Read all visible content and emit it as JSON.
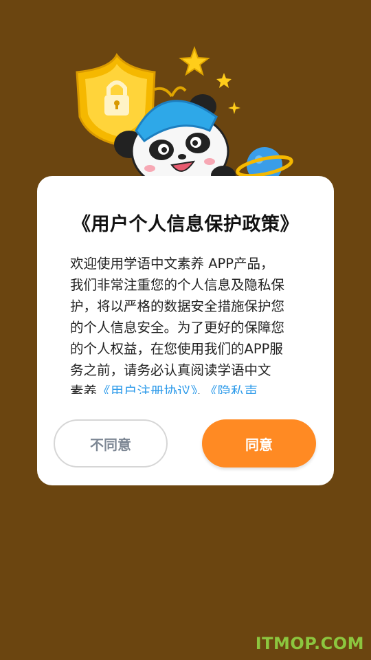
{
  "dialog": {
    "title": "《用户个人信息保护政策》",
    "body_lines": [
      "欢迎使用学语中文素养 APP产品，",
      "我们非常注重您的个人信息及隐私保",
      "护，将以严格的数据安全措施保护您",
      "的个人信息安全。为了更好的保障您",
      "的个人权益，在您使用我们的APP服",
      "务之前，请务必认真阅读学语中文"
    ],
    "last_line_prefix": "素养",
    "link_user_agreement": "《用户注册协议》",
    "link_connector": "、",
    "link_privacy": "《隐私声",
    "disagree_label": "不同意",
    "agree_label": "同意"
  },
  "illustration": {
    "icons": [
      "shield-lock-icon",
      "star-icon",
      "panda-mascot",
      "planet-icon"
    ]
  },
  "watermark": "ITMOP.COM",
  "colors": {
    "background": "#6b4510",
    "accent": "#ff8a23",
    "link": "#2e9bea",
    "watermark": "#8cc63f"
  }
}
